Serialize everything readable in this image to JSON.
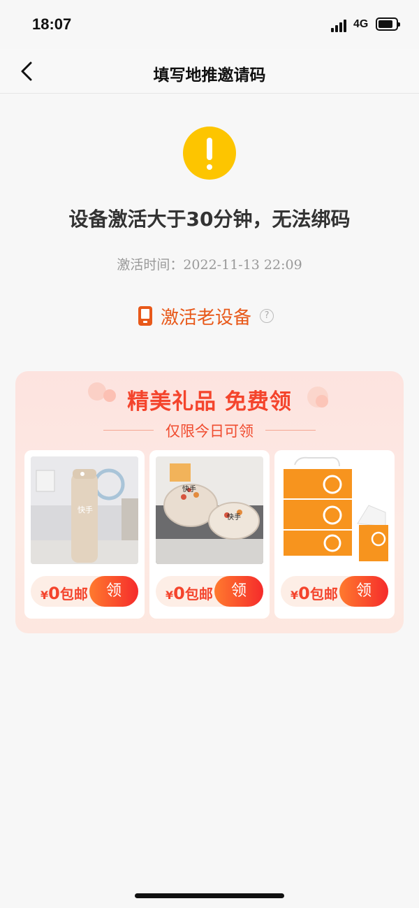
{
  "status_bar": {
    "time": "18:07",
    "network": "4G"
  },
  "nav": {
    "title": "填写地推邀请码"
  },
  "notice": {
    "headline": "设备激活大于30分钟，无法绑码",
    "activation_label": "激活时间：",
    "activation_value": "2022-11-13 22:09"
  },
  "old_device": {
    "label": "激活老设备",
    "help": "?"
  },
  "gift": {
    "title": "精美礼品 免费领",
    "subtitle": "仅限今日可领",
    "items": [
      {
        "product": "bottle",
        "brand_text": "快手",
        "price_yen": "¥",
        "price_value": "0",
        "price_suffix": "包邮",
        "button_label": "领"
      },
      {
        "product": "glass-bowls",
        "brand_text": "快手",
        "price_yen": "¥",
        "price_value": "0",
        "price_suffix": "包邮",
        "button_label": "领"
      },
      {
        "product": "tissue-boxes",
        "brand_text": "",
        "price_yen": "¥",
        "price_value": "0",
        "price_suffix": "包邮",
        "button_label": "领"
      }
    ]
  },
  "colors": {
    "accent": "#e8591a",
    "warning": "#fdc500",
    "gift_red": "#f4442c"
  }
}
